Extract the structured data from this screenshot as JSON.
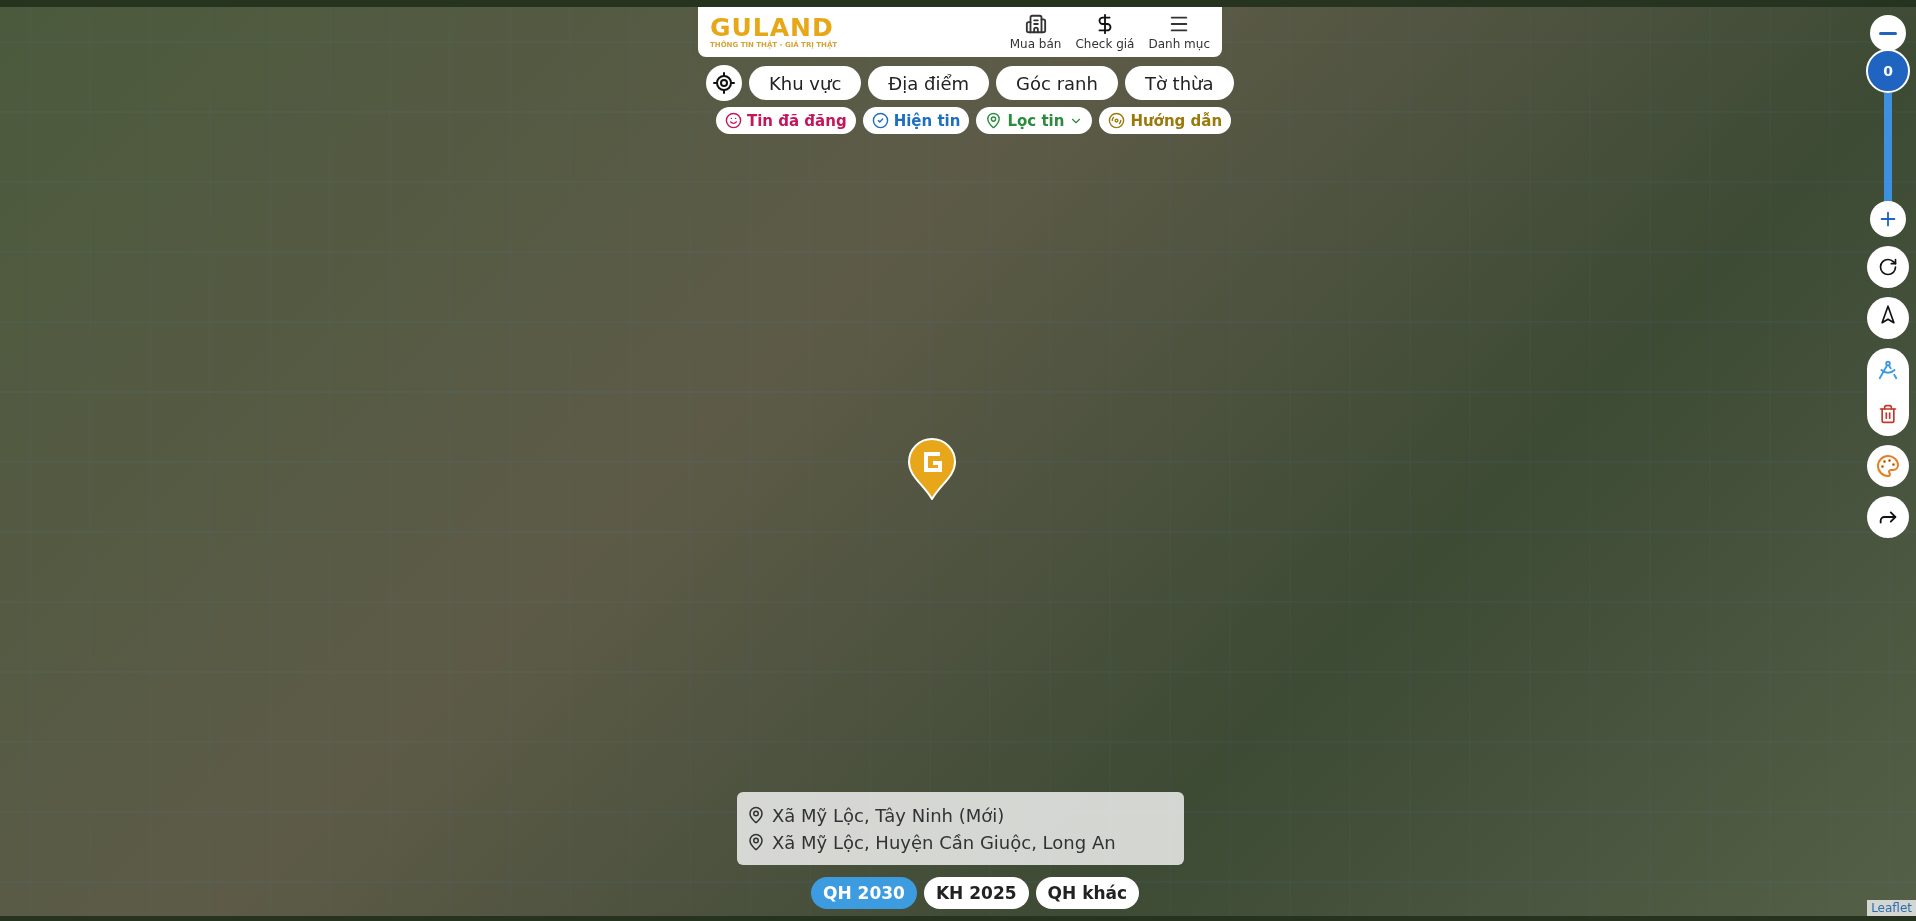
{
  "brand": {
    "name": "GULAND",
    "tagline": "THÔNG TIN THẬT - GIÁ TRỊ THẬT"
  },
  "nav": [
    {
      "label": "Mua bán",
      "kind": "buildings"
    },
    {
      "label": "Check giá",
      "kind": "dollar"
    },
    {
      "label": "Danh mục",
      "kind": "menu"
    }
  ],
  "search_tabs": [
    "Khu vực",
    "Địa điểm",
    "Góc ranh",
    "Tờ thừa"
  ],
  "actions": [
    {
      "label": "Tin đã đăng",
      "kind": "posted",
      "color": "#c2185b",
      "dropdown": false
    },
    {
      "label": "Hiện tin",
      "kind": "show",
      "color": "#1e6fc0",
      "dropdown": false
    },
    {
      "label": "Lọc tin",
      "kind": "filter",
      "color": "#2e8b3e",
      "dropdown": true
    },
    {
      "label": "Hướng dẫn",
      "kind": "guide",
      "color": "#9a7a0c",
      "dropdown": false
    }
  ],
  "zoom": {
    "level": 1,
    "reading": "0"
  },
  "addresses": [
    "Xã Mỹ Lộc, Tây Ninh (Mới)",
    "Xã Mỹ Lộc, Huyện Cần Giuộc, Long An"
  ],
  "plan_layers": [
    {
      "label": "QH 2030",
      "selected": true
    },
    {
      "label": "KH 2025",
      "selected": false
    },
    {
      "label": "QH khác",
      "selected": false
    }
  ],
  "attribution": "Leaflet"
}
